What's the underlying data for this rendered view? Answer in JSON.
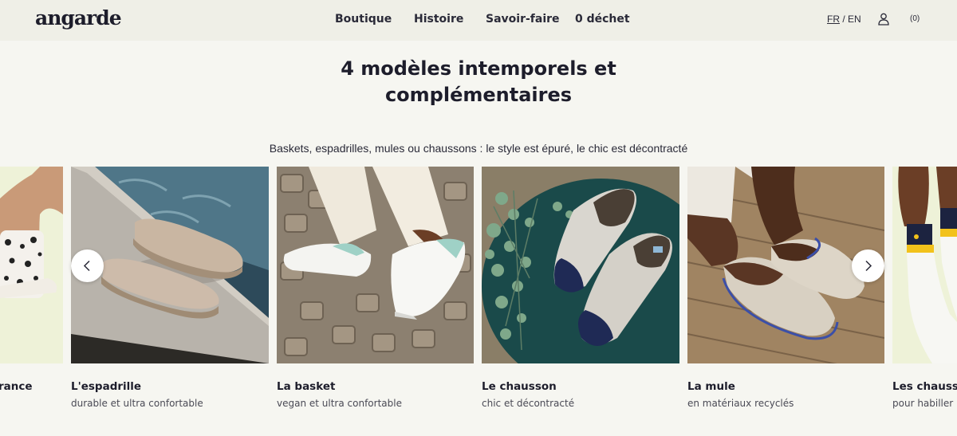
{
  "header": {
    "logo": "angarde",
    "nav": [
      "Boutique",
      "Histoire",
      "Savoir-faire",
      "0 déchet"
    ],
    "lang_fr": "FR",
    "lang_sep": "/",
    "lang_en": "EN",
    "cart": "(0)"
  },
  "hero": {
    "title_line1": "4 modèles intemporels et",
    "title_line2": "complémentaires",
    "subtitle": "Baskets, espadrilles, mules ou chaussons : le style est épuré, le chic est décontracté"
  },
  "carousel": {
    "cards": [
      {
        "name": "rance",
        "desc": ""
      },
      {
        "name": "L'espadrille",
        "desc": "durable et ultra confortable"
      },
      {
        "name": "La basket",
        "desc": "vegan et ultra confortable"
      },
      {
        "name": "Le chausson",
        "desc": "chic et décontracté"
      },
      {
        "name": "La mule",
        "desc": "en matériaux recyclés"
      },
      {
        "name": "Les chaussett",
        "desc": "pour habiller m"
      }
    ]
  },
  "colors": {
    "background": "#f6f6f1",
    "header_bg": "#efefe7",
    "text_dark": "#1d1d2b",
    "text_muted": "#4a4a55"
  },
  "icons": {
    "account": "user-icon",
    "prev": "chevron-left-icon",
    "next": "chevron-right-icon"
  }
}
